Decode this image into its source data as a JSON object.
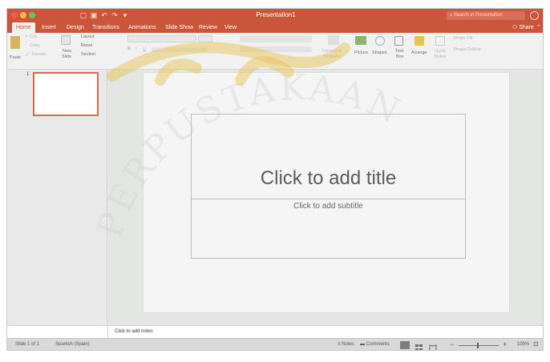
{
  "window": {
    "title": "Presentation1"
  },
  "quick_access": [
    "home-icon",
    "save-icon",
    "undo-icon",
    "redo-icon",
    "customize-icon"
  ],
  "search": {
    "placeholder": "Search in Presentation"
  },
  "tabs": [
    {
      "label": "Home",
      "active": true
    },
    {
      "label": "Insert"
    },
    {
      "label": "Design"
    },
    {
      "label": "Transitions"
    },
    {
      "label": "Animations"
    },
    {
      "label": "Slide Show"
    },
    {
      "label": "Review"
    },
    {
      "label": "View"
    }
  ],
  "share": {
    "label": "Share"
  },
  "ribbon": {
    "paste": "Paste",
    "cut": "Cut",
    "copy": "Copy",
    "format": "Format",
    "new_slide_1": "New",
    "new_slide_2": "Slide",
    "layout": "Layout",
    "reset": "Reset",
    "section": "Section",
    "smartart_1": "Convert to",
    "smartart_2": "SmartArt",
    "picture": "Picture",
    "shapes": "Shapes",
    "text_box_1": "Text",
    "text_box_2": "Box",
    "arrange": "Arrange",
    "quick_styles_1": "Quick",
    "quick_styles_2": "Styles",
    "shape_fill": "Shape Fill",
    "shape_outline": "Shape Outline"
  },
  "thumbnails": {
    "slide_number": "1"
  },
  "slide": {
    "title_placeholder": "Click to add title",
    "subtitle_placeholder": "Click to add subtitle"
  },
  "notes": {
    "placeholder": "Click to add notes"
  },
  "status": {
    "slide_count": "Slide 1 of 1",
    "language": "Spanish (Spain)",
    "notes_btn": "Notes",
    "comments_btn": "Comments",
    "zoom_minus": "−",
    "zoom_plus": "+",
    "zoom_level": "105%"
  },
  "watermark": {
    "text": "PERPUSTAKAAN"
  },
  "colors": {
    "accent": "#c9553a",
    "title_bar": "#c9553a",
    "ribbon_bg": "#f1f1f1",
    "watermark": "#e8c14a"
  }
}
